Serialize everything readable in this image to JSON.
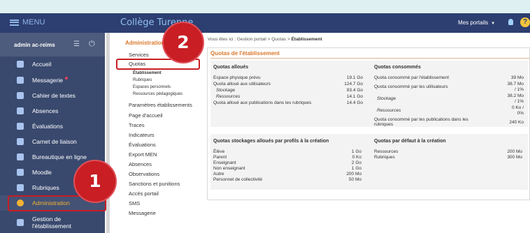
{
  "header": {
    "menu_label": "MENU",
    "site_title": "Collège Turenne",
    "my_portals": "Mes portails",
    "help": "?"
  },
  "user": {
    "name": "admin ac-reims"
  },
  "sidebar": {
    "items": [
      {
        "label": "Accueil",
        "icon": "home-icon"
      },
      {
        "label": "Messagerie",
        "icon": "mail-icon"
      },
      {
        "label": "Cahier de textes",
        "icon": "book-icon"
      },
      {
        "label": "Absences",
        "icon": "user-icon"
      },
      {
        "label": "Évaluations",
        "icon": "chart-icon"
      },
      {
        "label": "Carnet de liaison",
        "icon": "link-icon"
      },
      {
        "label": "Bureautique en ligne",
        "icon": "document-icon"
      },
      {
        "label": "Moodle",
        "icon": "moodle-icon"
      },
      {
        "label": "Rubriques",
        "icon": "folder-icon"
      },
      {
        "label": "Administration",
        "icon": "gear-icon"
      },
      {
        "label": "Gestion de l'établissement",
        "icon": "location-icon"
      }
    ]
  },
  "callouts": {
    "one": "1",
    "two": "2"
  },
  "subnav": {
    "title": "Administration",
    "items": [
      "Services",
      "Quotas",
      "Paramètres établissements",
      "Page d'accueil",
      "Traces",
      "Indicateurs",
      "Évaluations",
      "Export MEN",
      "Absences",
      "Observations",
      "Sanctions et punitions",
      "Accès portail",
      "SMS",
      "Messagerie"
    ],
    "quota_subitems": [
      "Établissement",
      "Rubriques",
      "Espaces personnels",
      "Ressources pédagogiques"
    ]
  },
  "breadcrumb": {
    "prefix": "Vous êtes ici : Gestion portail > Quotas > ",
    "current": "Établissement"
  },
  "main": {
    "title": "Quotas de l'établissement",
    "alloues": {
      "title": "Quotas alloués",
      "rows": [
        {
          "label": "Espace physique prévu",
          "value": "19.1 Go"
        },
        {
          "label": "Quota alloué aux utilisateurs",
          "value": "124.7 Go"
        },
        {
          "label": "Stockage",
          "value": "93.4 Go"
        },
        {
          "label": "Ressources",
          "value": "14.1 Go"
        },
        {
          "label": "Quota alloué aux publications dans les rubriques",
          "value": "14.4 Go"
        }
      ]
    },
    "consommes": {
      "title": "Quotas consommés",
      "rows": [
        {
          "label": "Quota consommé par l'établissement",
          "value": "39 Mo"
        },
        {
          "label": "Quota consommé par les utilisateurs",
          "value": "38.7 Mo",
          "value2": "/ 1%"
        },
        {
          "label": "Stockage",
          "value": "38.2 Mo",
          "value2": "/ 1%"
        },
        {
          "label": "Ressources",
          "value": "0 Ko /",
          "value2": "0%"
        },
        {
          "label": "Quota consommé par les publications dans les",
          "label2": "rubriques",
          "value": "240 Ko"
        }
      ]
    },
    "profils": {
      "title": "Quotas stockages alloués par profils à la création",
      "rows": [
        {
          "label": "Élève",
          "value": "1 Go"
        },
        {
          "label": "Parent",
          "value": "0 Ko"
        },
        {
          "label": "Enseignant",
          "value": "2 Go"
        },
        {
          "label": "Non enseignant",
          "value": "1 Go"
        },
        {
          "label": "Autre",
          "value": "200 Mo"
        },
        {
          "label": "Personnel de collectivité",
          "value": "50 Mo"
        }
      ]
    },
    "defaut": {
      "title": "Quotas par défaut à la création",
      "rows": [
        {
          "label": "Ressources",
          "value": "200 Mo"
        },
        {
          "label": "Rubriques",
          "value": "300 Mo"
        }
      ]
    }
  },
  "colors": {
    "header": "#2d3e70",
    "sidebar": "#39496e",
    "accent": "#d9772c",
    "highlight": "#c81e24",
    "admin": "#f2b233"
  }
}
